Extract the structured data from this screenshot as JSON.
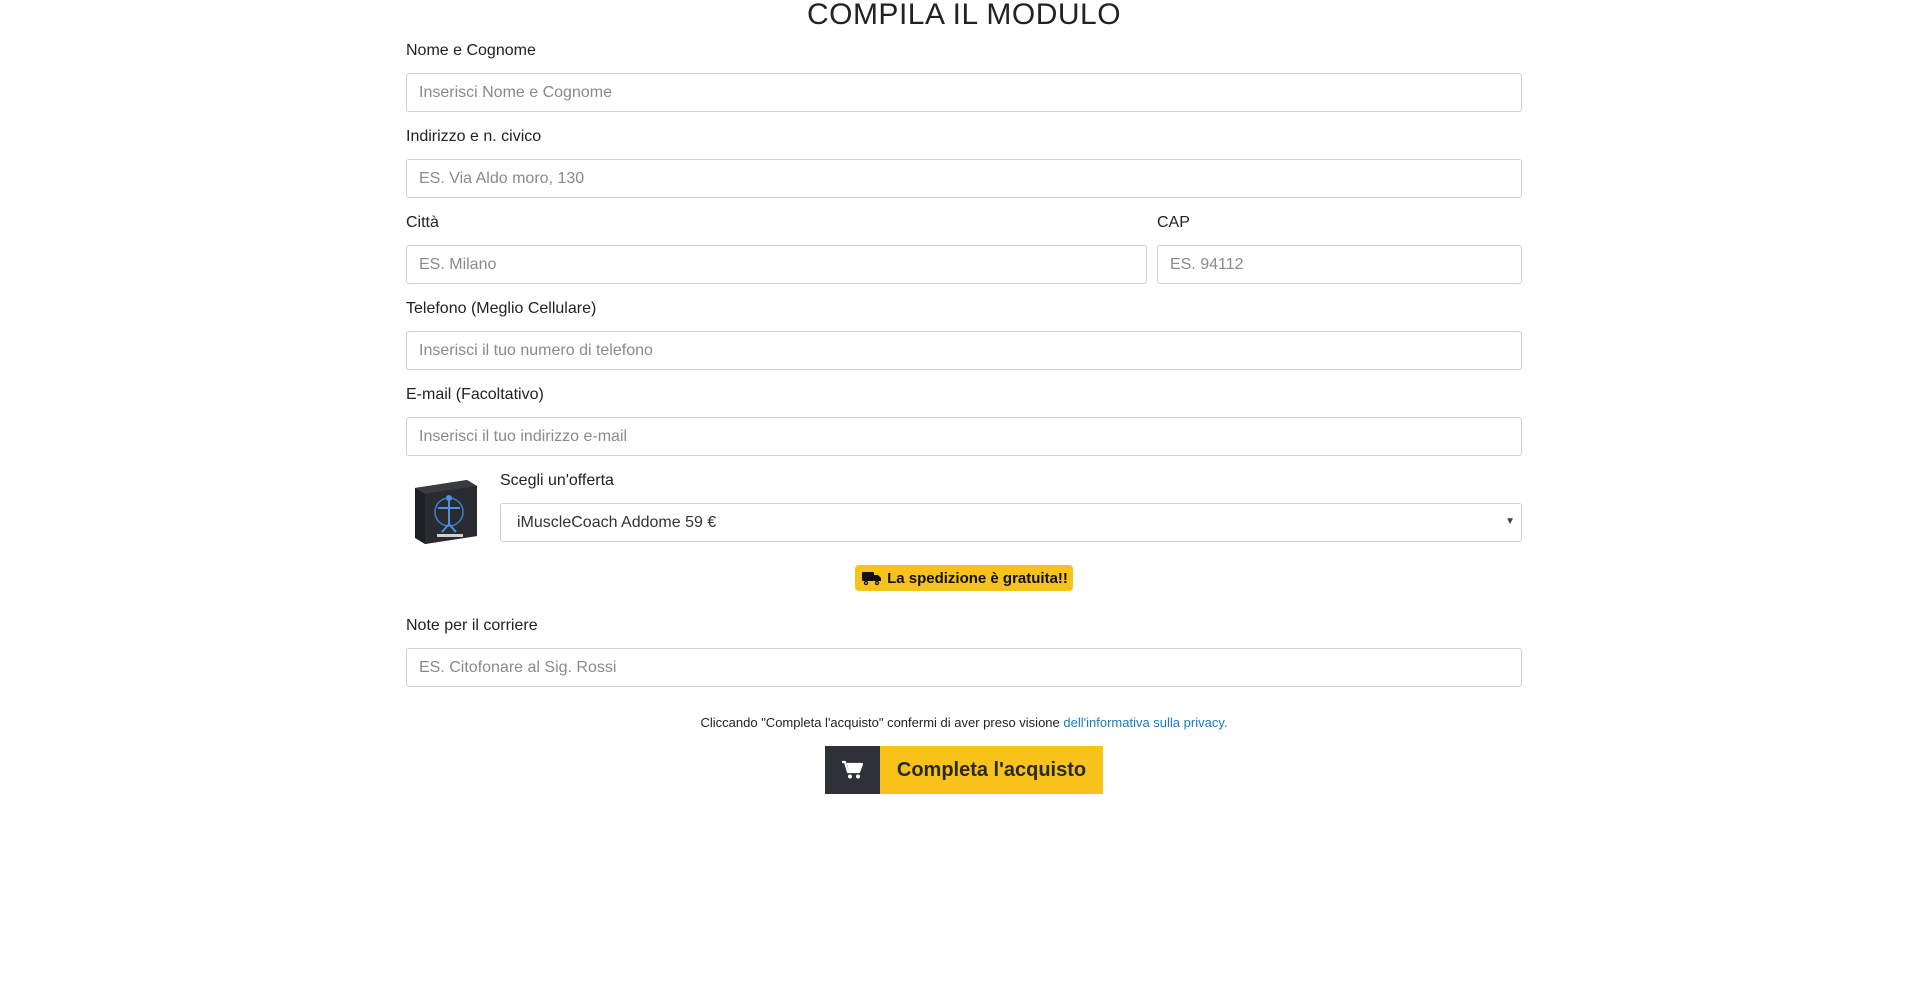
{
  "form": {
    "title": "COMPILA IL MODULO",
    "name": {
      "label": "Nome e Cognome",
      "placeholder": "Inserisci Nome e Cognome"
    },
    "address": {
      "label": "Indirizzo e n. civico",
      "placeholder": "ES. Via Aldo moro, 130"
    },
    "city": {
      "label": "Città",
      "placeholder": "ES. Milano"
    },
    "cap": {
      "label": "CAP",
      "placeholder": "ES. 94112"
    },
    "phone": {
      "label": "Telefono (Meglio Cellulare)",
      "placeholder": "Inserisci il tuo numero di telefono"
    },
    "email": {
      "label": "E-mail (Facoltativo)",
      "placeholder": "Inserisci il tuo indirizzo e-mail"
    },
    "offer": {
      "label": "Scegli un'offerta",
      "selected": "iMuscleCoach Addome 59 €"
    },
    "shipping_badge": "La spedizione è gratuita!!",
    "notes": {
      "label": "Note per il corriere",
      "placeholder": "ES. Citofonare al Sig. Rossi"
    },
    "privacy_text": "Cliccando \"Completa l'acquisto\" confermi di aver preso visione ",
    "privacy_link": "dell'informativa sulla privacy.",
    "submit_label": "Completa l'acquisto"
  },
  "icons": {
    "shipping": "truck-icon",
    "submit": "shopping-cart-icon",
    "select": "caret-down-icon"
  },
  "colors": {
    "accent": "#f7c21a",
    "button_icon_bg": "#2f3138",
    "link": "#1a7ac0"
  }
}
